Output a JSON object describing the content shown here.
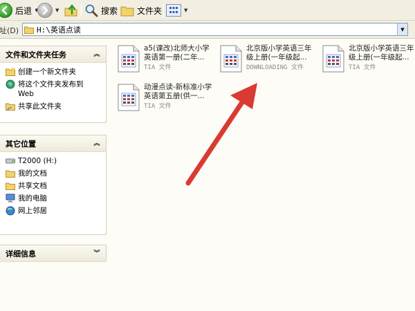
{
  "toolbar": {
    "back_label": "后退",
    "search_label": "搜索",
    "folders_label": "文件夹"
  },
  "address": {
    "label": "地址(D)",
    "path": "H:\\英语点读"
  },
  "tasks_pane": {
    "title": "文件和文件夹任务",
    "items": [
      {
        "label": "创建一个新文件夹",
        "icon": "new-folder-icon"
      },
      {
        "label": "将这个文件夹发布到 Web",
        "icon": "web-publish-icon"
      },
      {
        "label": "共享此文件夹",
        "icon": "share-folder-icon"
      }
    ]
  },
  "places_pane": {
    "title": "其它位置",
    "items": [
      {
        "label": "T2000 (H:)",
        "icon": "drive-icon"
      },
      {
        "label": "我的文档",
        "icon": "my-documents-icon"
      },
      {
        "label": "共享文档",
        "icon": "shared-documents-icon"
      },
      {
        "label": "我的电脑",
        "icon": "my-computer-icon"
      },
      {
        "label": "网上邻居",
        "icon": "network-places-icon"
      }
    ]
  },
  "details_pane": {
    "title": "详细信息"
  },
  "files": [
    {
      "name_line1": "a5(课改)北师大小学",
      "name_line2": "英语第一册(二年...",
      "type": "TIA 文件"
    },
    {
      "name_line1": "北京版小学英语三年",
      "name_line2": "级上册(一年级起...",
      "type": "DOWNLOADING 文件"
    },
    {
      "name_line1": "北京版小学英语三年",
      "name_line2": "级上册(一年级起...",
      "type": "TIA 文件"
    },
    {
      "name_line1": "动漫点读-新标准小学",
      "name_line2": "英语第五册(供一...",
      "type": "TIA 文件"
    }
  ],
  "colors": {
    "annotation_arrow": "#d93a32",
    "toolbar_bg": "#f2efe2",
    "pane_bg": "#ffffff"
  }
}
